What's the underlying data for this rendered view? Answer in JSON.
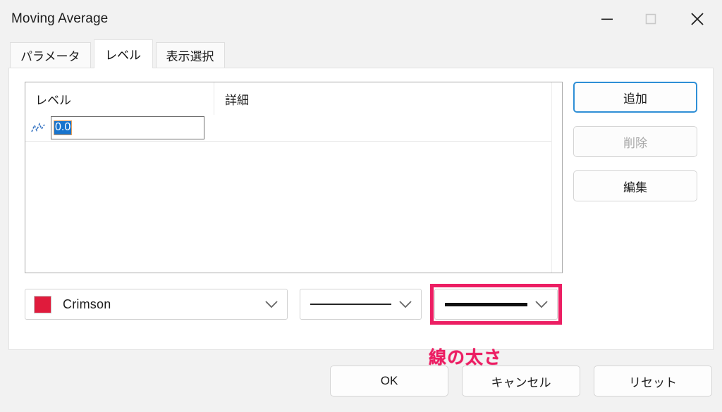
{
  "window": {
    "title": "Moving Average",
    "controls": {
      "minimize": "minimize-button",
      "maximize": "maximize-button",
      "close": "close-button"
    }
  },
  "tabs": [
    {
      "label": "パラメータ",
      "selected": false
    },
    {
      "label": "レベル",
      "selected": true
    },
    {
      "label": "表示選択",
      "selected": false
    }
  ],
  "list": {
    "columns": [
      {
        "label": "レベル"
      },
      {
        "label": "詳細"
      }
    ],
    "rows": [
      {
        "icon": "level-line-icon",
        "level": "0.0",
        "detail": "",
        "editing": true,
        "selected_text": "0.0"
      }
    ]
  },
  "side_buttons": [
    {
      "label": "追加",
      "state": "focused"
    },
    {
      "label": "削除",
      "state": "disabled"
    },
    {
      "label": "編集",
      "state": "normal"
    }
  ],
  "controls": {
    "color": {
      "value": "Crimson",
      "swatch_hex": "#e01b3c"
    },
    "line_style": {
      "value": "solid-thin-line"
    },
    "line_width": {
      "value": "solid-thick-line",
      "highlighted": true
    }
  },
  "annotation": {
    "text": "線の太さ",
    "color": "#ec1e63"
  },
  "footer_buttons": [
    {
      "label": "OK"
    },
    {
      "label": "キャンセル"
    },
    {
      "label": "リセット"
    }
  ]
}
